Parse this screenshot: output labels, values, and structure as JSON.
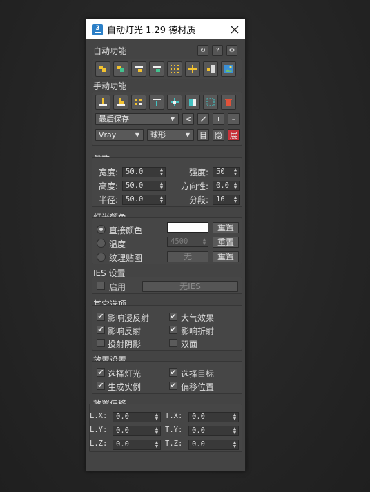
{
  "window": {
    "title": "自动灯光 1.29 德材质",
    "app_icon": "3"
  },
  "auto": {
    "heading": "自动功能",
    "head_icons": [
      "refresh-icon",
      "help-icon",
      "gear-icon"
    ],
    "help_glyph": "?",
    "refresh_glyph": "↻",
    "gear_glyph": "⚙"
  },
  "manual": {
    "heading": "手动功能",
    "preset": "最后保存",
    "prev_glyph": "<",
    "edit_glyph": "/",
    "add_glyph": "+",
    "remove_glyph": "–",
    "renderer": "Vray",
    "shape": "球形",
    "btn_catalog": "目",
    "btn_hide": "隐",
    "btn_expand": "展"
  },
  "params": {
    "heading": "参数",
    "width_label": "宽度:",
    "width_value": "50.0",
    "height_label": "高度:",
    "height_value": "50.0",
    "radius_label": "半径:",
    "radius_value": "50.0",
    "intensity_label": "强度:",
    "intensity_value": "50",
    "direction_label": "方向性:",
    "direction_value": "0.0",
    "segments_label": "分段:",
    "segments_value": "16"
  },
  "color": {
    "heading": "灯光颜色",
    "direct_label": "直接颜色",
    "temp_label": "温度",
    "temp_value": "4500",
    "tex_label": "纹理贴图",
    "tex_button": "无",
    "reset": "重置",
    "swatch_color": "#ffffff"
  },
  "ies": {
    "heading": "IES 设置",
    "enable_label": "启用",
    "button": "无IES"
  },
  "other": {
    "heading": "其它选项",
    "affect_diffuse": "影响漫反射",
    "atmosphere": "大气效果",
    "affect_reflect": "影响反射",
    "affect_refract": "影响折射",
    "cast_shadow": "投射阴影",
    "double_sided": "双面"
  },
  "place": {
    "heading": "放置设置",
    "select_light": "选择灯光",
    "select_target": "选择目标",
    "instance": "生成实例",
    "offset_position": "偏移位置"
  },
  "offset": {
    "heading": "放置偏移",
    "lx_label": "L.X:",
    "lx_value": "0.0",
    "ly_label": "L.Y:",
    "ly_value": "0.0",
    "lz_label": "L.Z:",
    "lz_value": "0.0",
    "tx_label": "T.X:",
    "tx_value": "0.0",
    "ty_label": "T.Y:",
    "ty_value": "0.0",
    "tz_label": "T.Z:",
    "tz_value": "0.0"
  },
  "check_glyph": "✔"
}
